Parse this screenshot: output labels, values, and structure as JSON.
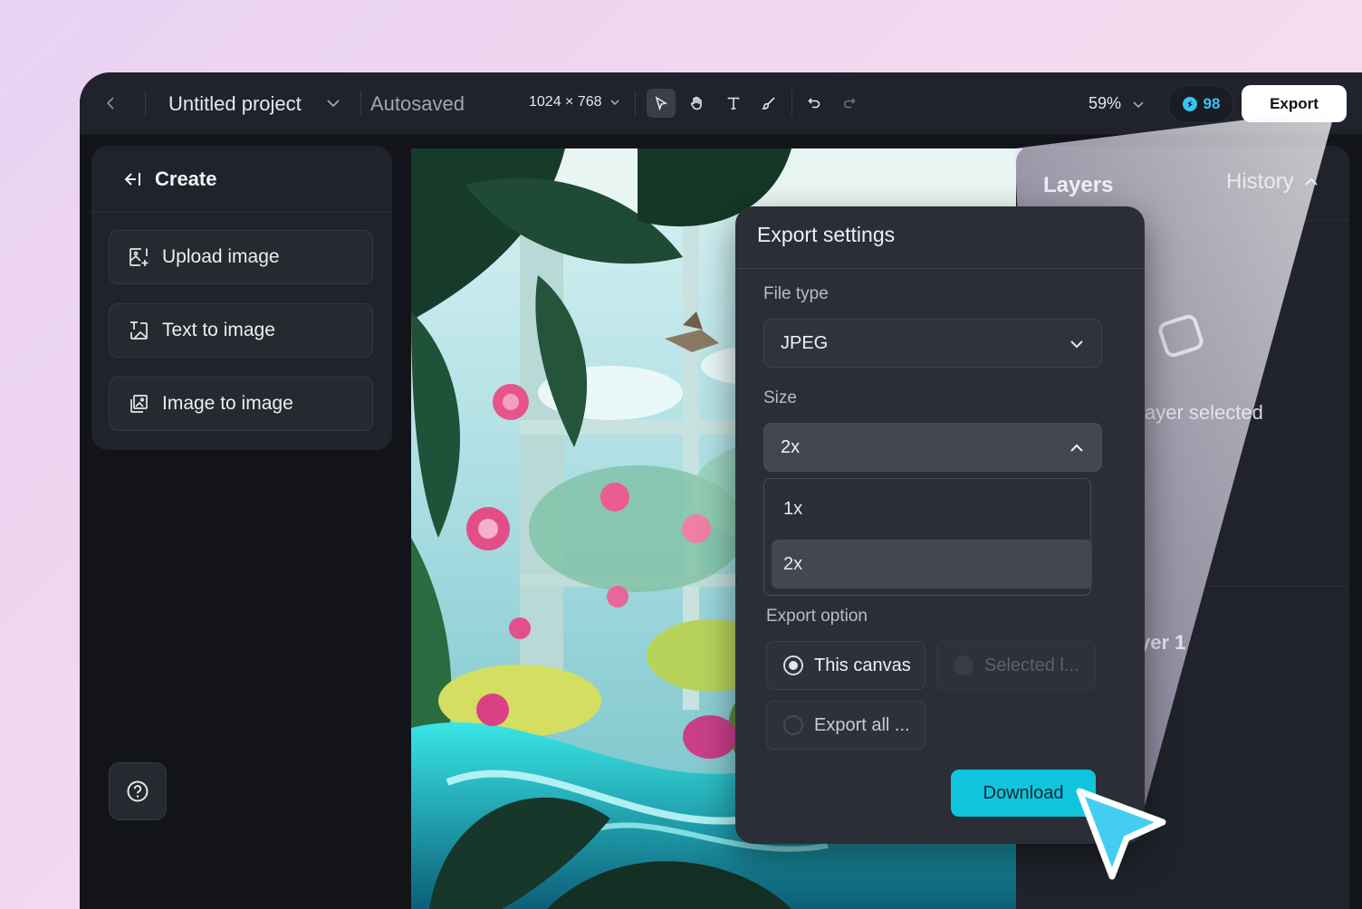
{
  "topbar": {
    "back_icon": "chevron-left-icon",
    "project_name": "Untitled project",
    "save_status": "Autosaved",
    "canvas_size": "1024 × 768",
    "tools": [
      "select-arrow-icon",
      "hand-icon",
      "text-icon",
      "brush-icon",
      "undo-icon",
      "redo-icon"
    ],
    "zoom": "59%",
    "credits": "98",
    "export_label": "Export"
  },
  "left_panel": {
    "header": "Create",
    "items": [
      {
        "label": "Upload image",
        "icon": "upload-image-icon"
      },
      {
        "label": "Text to image",
        "icon": "text-to-image-icon"
      },
      {
        "label": "Image to image",
        "icon": "image-to-image-icon"
      }
    ],
    "help_icon": "help-circle-icon"
  },
  "right_panel": {
    "tab_layers": "Layers",
    "tab_history": "History",
    "empty_state": "ayer selected",
    "layer_name": "yer 1"
  },
  "export_modal": {
    "title": "Export settings",
    "file_type_label": "File type",
    "file_type_value": "JPEG",
    "size_label": "Size",
    "size_value": "2x",
    "size_options": [
      "1x",
      "2x"
    ],
    "export_option_label": "Export option",
    "options": [
      {
        "label": "This canvas",
        "selected": true,
        "enabled": true
      },
      {
        "label": "Selected l...",
        "selected": false,
        "enabled": false
      },
      {
        "label": "Export all ...",
        "selected": false,
        "enabled": true
      }
    ],
    "download_label": "Download"
  },
  "colors": {
    "accent": "#0fc4dc",
    "credits": "#35c6f1",
    "app_bg": "#121419",
    "panel_bg": "#20232b"
  }
}
